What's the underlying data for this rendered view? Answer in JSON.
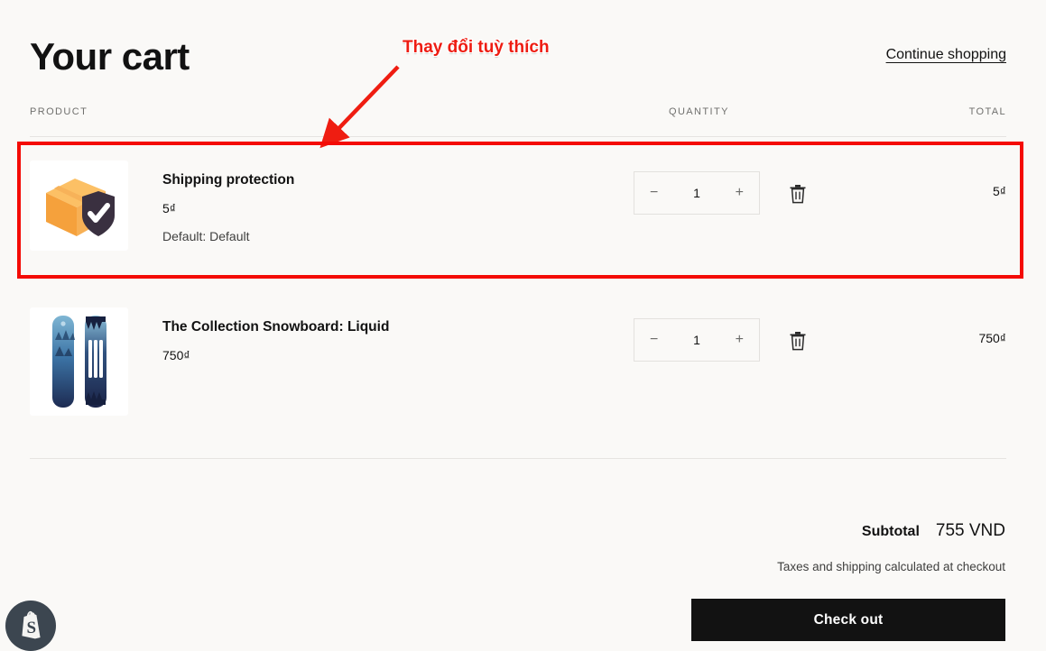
{
  "header": {
    "title": "Your cart",
    "continue_shopping": "Continue shopping"
  },
  "columns": {
    "product": "PRODUCT",
    "quantity": "QUANTITY",
    "total": "TOTAL"
  },
  "items": [
    {
      "title": "Shipping protection",
      "price": "5₫",
      "variant": "Default: Default",
      "quantity": "1",
      "line_total": "5₫",
      "minus_label": "−",
      "plus_label": "+",
      "image_alt": "shipping-protection-box-shield"
    },
    {
      "title": "The Collection Snowboard: Liquid",
      "price": "750₫",
      "variant": "",
      "quantity": "1",
      "line_total": "750₫",
      "minus_label": "−",
      "plus_label": "+",
      "image_alt": "liquid-snowboard-pair"
    }
  ],
  "summary": {
    "subtotal_label": "Subtotal",
    "subtotal_value": "755 VND",
    "tax_note": "Taxes and shipping calculated at checkout",
    "checkout_label": "Check out"
  },
  "annotations": {
    "note_text": "Thay đổi tuỳ thích",
    "highlight_color": "#f40b05",
    "note_color": "#ee1c12"
  },
  "widget": {
    "shopify_label": "shopify-logo-icon"
  }
}
